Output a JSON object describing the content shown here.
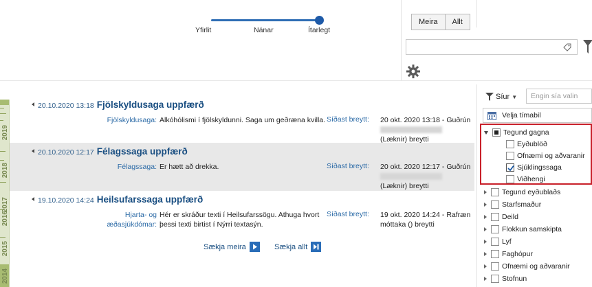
{
  "detail_slider": {
    "labels": [
      "Yfirlit",
      "Nánar",
      "Ítarlegt"
    ],
    "selected": "Ítarlegt"
  },
  "view_toggle": {
    "more_label": "Meira",
    "all_label": "Allt"
  },
  "search": {
    "value": ""
  },
  "timeline": {
    "years": [
      "2019",
      "2018",
      "2017",
      "2016",
      "2015",
      "2014"
    ]
  },
  "events": [
    {
      "datetime": "20.10.2020 13:18",
      "title": "Fjölskyldusaga uppfærð",
      "field_label": "Fjölskyldusaga:",
      "field_value": "Alkóhólismi í fjölskyldunni. Saga um geðræna kvilla.",
      "changed_label": "Síðast breytt:",
      "changed_value": "20 okt. 2020 13:18 - Guðrún",
      "changed_suffix": "(Læknir) breytti"
    },
    {
      "datetime": "20.10.2020 12:17",
      "title": "Félagssaga uppfærð",
      "field_label": "Félagssaga:",
      "field_value": "Er hætt að drekka.",
      "changed_label": "Síðast breytt:",
      "changed_value": "20 okt. 2020 12:17 - Guðrún",
      "changed_suffix": "(Læknir) breytti"
    },
    {
      "datetime": "19.10.2020 14:24",
      "title": "Heilsufarssaga uppfærð",
      "field_label_line1": "Hjarta- og",
      "field_label_line2": "æðasjúkdómar:",
      "field_value": "Hér er skráður texti í Heilsufarssögu. Athuga hvort þessi texti birtist í Nýrri textasýn.",
      "changed_label": "Síðast breytt:",
      "changed_value": "19 okt. 2020 14:24 - Rafræn móttaka () breytti"
    }
  ],
  "load_more_label": "Sækja meira",
  "load_all_label": "Sækja allt",
  "filter_panel": {
    "filter_label": "Síur",
    "filter_placeholder": "Engin sía valin",
    "period_label": "Velja tímabil",
    "tree": {
      "group_label": "Tegund gagna",
      "children": [
        {
          "label": "Eyðublöð",
          "checked": false
        },
        {
          "label": "Ofnæmi og aðvaranir",
          "checked": false
        },
        {
          "label": "Sjúklingssaga",
          "checked": true
        },
        {
          "label": "Viðhengi",
          "checked": false
        }
      ],
      "other_groups": [
        "Tegund eyðublaðs",
        "Starfsmaður",
        "Deild",
        "Flokkun samskipta",
        "Lyf",
        "Faghópur",
        "Ofnæmi og aðvaranir",
        "Stofnun"
      ]
    }
  },
  "colors": {
    "accent": "#1a4f82",
    "highlight_border": "#c8202a",
    "timeline": "#a8bc72"
  }
}
